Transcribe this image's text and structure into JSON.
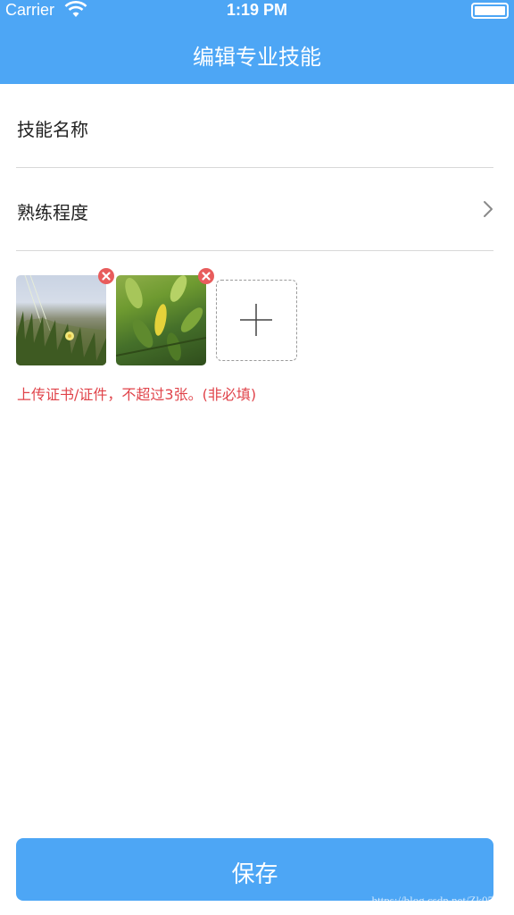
{
  "status_bar": {
    "carrier": "Carrier",
    "time": "1:19 PM"
  },
  "nav": {
    "title": "编辑专业技能"
  },
  "form": {
    "skill_name_label": "技能名称",
    "proficiency_label": "熟练程度",
    "upload_hint": "上传证书/证件，不超过3张。(非必填)"
  },
  "photos": {
    "count": 2,
    "max": 3
  },
  "save_button": {
    "label": "保存"
  },
  "watermark": "https://blog.csdn.net/Zk0553",
  "colors": {
    "brand": "#4da6f5",
    "hint": "#e0434a",
    "delete_badge": "#e85c5c"
  }
}
